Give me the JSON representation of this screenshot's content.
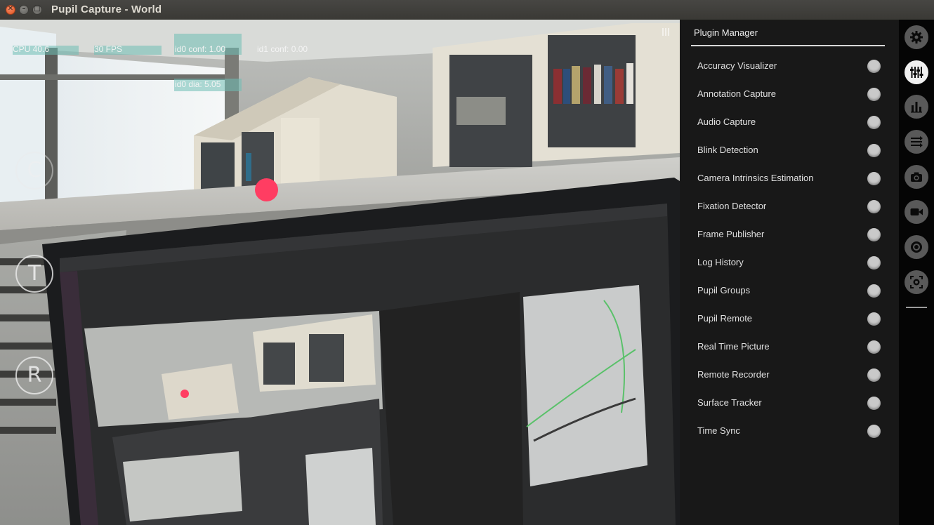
{
  "window": {
    "title": "Pupil Capture - World",
    "close_glyph": "✕",
    "min_glyph": "–",
    "max_glyph": "□"
  },
  "stats": {
    "cpu": "CPU 40.6",
    "fps": "30 FPS",
    "id0_conf": "id0 conf: 1.00",
    "id1_conf": "id1 conf: 0.00",
    "id0_dia": "id0 dia: 5.05"
  },
  "side_buttons": {
    "calibrate": "C",
    "test": "T",
    "record": "R"
  },
  "plugin_manager": {
    "title": "Plugin Manager",
    "plugins": [
      "Accuracy Visualizer",
      "Annotation Capture",
      "Audio Capture",
      "Blink Detection",
      "Camera Intrinsics Estimation",
      "Fixation Detector",
      "Frame Publisher",
      "Log History",
      "Pupil Groups",
      "Pupil Remote",
      "Real Time Picture",
      "Remote Recorder",
      "Surface Tracker",
      "Time Sync"
    ]
  },
  "menu_icons": [
    "gear-icon",
    "sliders-icon",
    "bar-chart-icon",
    "list-arrows-icon",
    "camera-icon",
    "video-camera-icon",
    "target-icon",
    "screen-marker-icon"
  ],
  "colors": {
    "gaze_dot": "#ff3d62",
    "active_menu": "#f0f0f0",
    "inactive_menu": "#595959"
  }
}
